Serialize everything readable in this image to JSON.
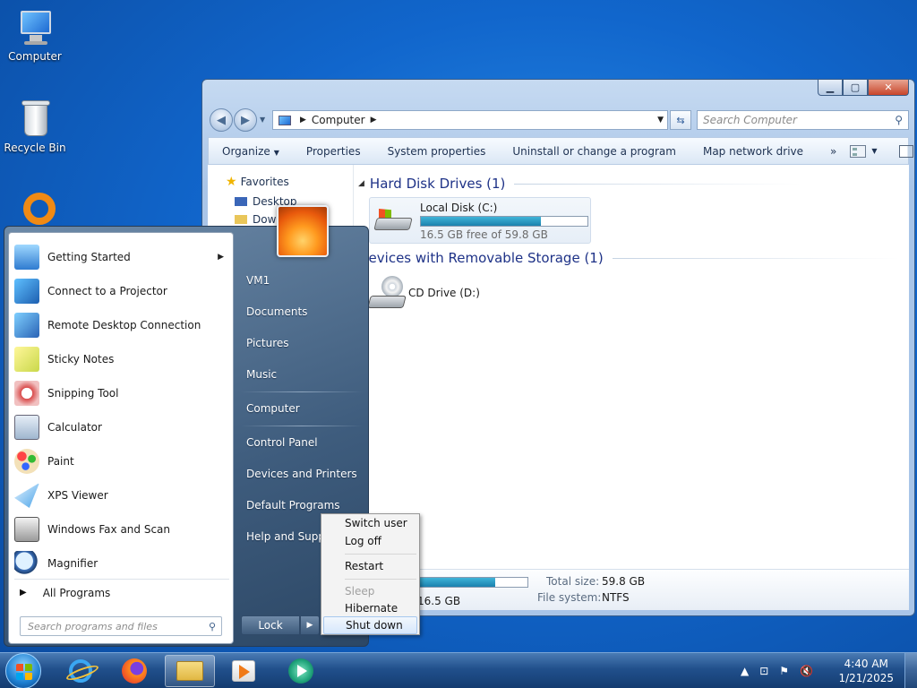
{
  "desktop": {
    "icons": [
      {
        "label": "Computer"
      },
      {
        "label": "Recycle Bin"
      }
    ]
  },
  "explorer": {
    "address": {
      "path": "Computer"
    },
    "search_placeholder": "Search Computer",
    "toolbar": {
      "organize": "Organize",
      "properties": "Properties",
      "system_properties": "System properties",
      "uninstall": "Uninstall or change a program",
      "map_drive": "Map network drive",
      "more": "»"
    },
    "nav_pane": {
      "favorites": "Favorites",
      "items": [
        "Desktop",
        "Downloads"
      ]
    },
    "groups": {
      "hdd": {
        "title": "Hard Disk Drives (1)"
      },
      "removable": {
        "title": "Devices with Removable Storage (1)"
      }
    },
    "local_disk": {
      "name": "Local Disk (C:)",
      "free_text": "16.5 GB free of 59.8 GB",
      "used_fraction": 0.72
    },
    "cd_drive": {
      "name": "CD Drive (D:)"
    },
    "details": {
      "free_space": "16.5 GB",
      "total_size_label": "Total size:",
      "total_size": "59.8 GB",
      "file_system_label": "File system:",
      "file_system": "NTFS"
    }
  },
  "start_menu": {
    "programs": [
      {
        "label": "Getting Started",
        "has_submenu": true
      },
      {
        "label": "Connect to a Projector"
      },
      {
        "label": "Remote Desktop Connection"
      },
      {
        "label": "Sticky Notes"
      },
      {
        "label": "Snipping Tool"
      },
      {
        "label": "Calculator"
      },
      {
        "label": "Paint"
      },
      {
        "label": "XPS Viewer"
      },
      {
        "label": "Windows Fax and Scan"
      },
      {
        "label": "Magnifier"
      }
    ],
    "all_programs": "All Programs",
    "search_placeholder": "Search programs and files",
    "right_links": {
      "user": "VM1",
      "documents": "Documents",
      "pictures": "Pictures",
      "music": "Music",
      "computer": "Computer",
      "control_panel": "Control Panel",
      "devices": "Devices and Printers",
      "default_programs": "Default Programs",
      "help": "Help and Support"
    },
    "lock": "Lock",
    "power_menu": {
      "switch_user": "Switch user",
      "log_off": "Log off",
      "restart": "Restart",
      "sleep": "Sleep",
      "hibernate": "Hibernate",
      "shut_down": "Shut down"
    }
  },
  "taskbar": {
    "clock": {
      "time": "4:40 AM",
      "date": "1/21/2025"
    },
    "tray_expand": "▲"
  }
}
